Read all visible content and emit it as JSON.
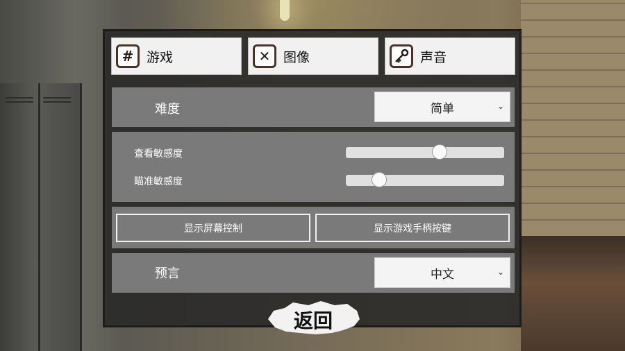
{
  "tabs": [
    {
      "label": "游戏",
      "icon": "hash-icon"
    },
    {
      "label": "图像",
      "icon": "x-icon"
    },
    {
      "label": "声音",
      "icon": "key-icon"
    }
  ],
  "difficulty": {
    "label": "难度",
    "value": "简单"
  },
  "sensitivity": {
    "look_label": "查看敏感度",
    "look_value": 0.59,
    "aim_label": "瞄准敏感度",
    "aim_value": 0.21
  },
  "controls": {
    "onscreen_label": "显示屏幕控制",
    "gamepad_label": "显示游戏手柄按键"
  },
  "language": {
    "label": "预言",
    "value": "中文"
  },
  "back_label": "返回"
}
